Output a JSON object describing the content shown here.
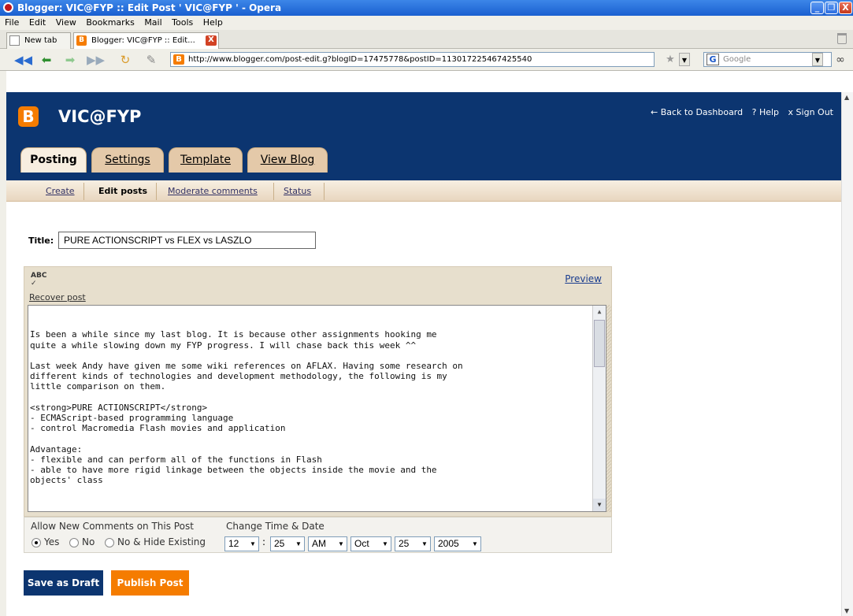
{
  "window": {
    "title": "Blogger: VIC@FYP :: Edit Post ' VIC@FYP ' - Opera",
    "minimize": "_",
    "restore": "❐",
    "close": "X"
  },
  "menu": [
    "File",
    "Edit",
    "View",
    "Bookmarks",
    "Mail",
    "Tools",
    "Help"
  ],
  "tabs": [
    {
      "label": "New tab",
      "active": false
    },
    {
      "label": "Blogger: VIC@FYP :: Edit...",
      "active": true,
      "close": "X"
    }
  ],
  "address": {
    "url": "http://www.blogger.com/post-edit.g?blogID=17475778&postID=113017225467425540",
    "search_placeholder": "Google"
  },
  "header": {
    "logo_letter": "B",
    "blog_name": "VIC@FYP",
    "links": [
      "← Back to Dashboard",
      "? Help",
      "x Sign Out"
    ]
  },
  "main_tabs": [
    {
      "label": "Posting",
      "active": true
    },
    {
      "label": "Settings",
      "active": false
    },
    {
      "label": "Template",
      "active": false
    },
    {
      "label": "View Blog",
      "active": false
    }
  ],
  "sub_tabs": [
    {
      "label": "Create",
      "active": false
    },
    {
      "label": "Edit posts",
      "active": true
    },
    {
      "label": "Moderate comments",
      "active": false
    },
    {
      "label": "Status",
      "active": false
    }
  ],
  "post": {
    "title_label": "Title:",
    "title_value": "PURE ACTIONSCRIPT vs FLEX vs LASZLO",
    "spell_glyph": "ABC",
    "preview_label": "Preview",
    "recover_label": "Recover post",
    "body": "Is been a while since my last blog. It is because other assignments hooking me\nquite a while slowing down my FYP progress. I will chase back this week ^^\n\nLast week Andy have given me some wiki references on AFLAX. Having some research on\ndifferent kinds of technologies and development methodology, the following is my\nlittle comparison on them.\n\n<strong>PURE ACTIONSCRIPT</strong>\n- ECMAScript-based programming language\n- control Macromedia Flash movies and application\n\nAdvantage:\n- flexible and can perform all of the functions in Flash\n- able to have more rigid linkage between the objects inside the movie and the\nobjects' class"
  },
  "options": {
    "comments_label": "Allow New Comments on This Post",
    "comment_choices": [
      {
        "label": "Yes",
        "selected": true
      },
      {
        "label": "No",
        "selected": false
      },
      {
        "label": "No & Hide Existing",
        "selected": false
      }
    ],
    "datetime_label": "Change Time & Date",
    "hour": "12",
    "minute": "25",
    "ampm": "AM",
    "month": "Oct",
    "day": "25",
    "year": "2005",
    "colon": ":"
  },
  "actions": {
    "save_draft": "Save as Draft",
    "publish": "Publish Post"
  }
}
